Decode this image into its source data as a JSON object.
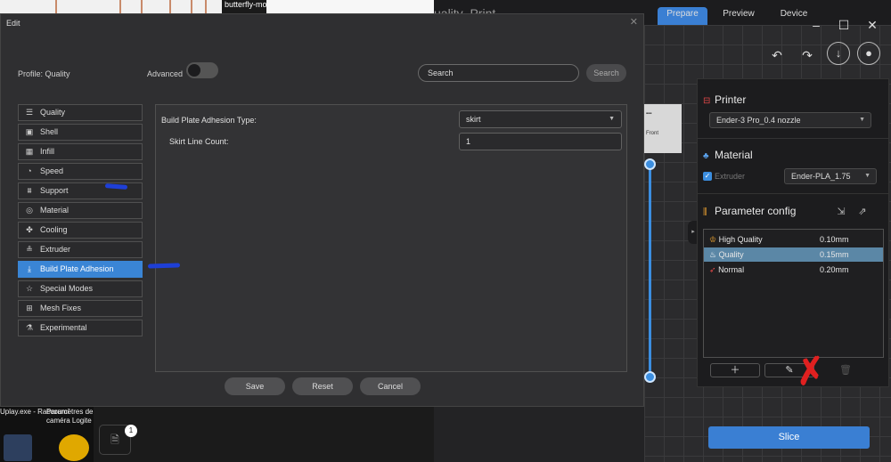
{
  "desktop": {
    "window_tab_label": "butterfly-mo",
    "icon_uplay": "Uplay.exe - Raccourci",
    "icon_camera": "Paramètres de caméra Logite",
    "notification_count": "1"
  },
  "app": {
    "title": "uality_Print",
    "tabs": [
      "Prepare",
      "Preview",
      "Device"
    ],
    "printer": {
      "heading": "Printer",
      "selected": "Ender-3 Pro_0.4 nozzle"
    },
    "material": {
      "heading": "Material",
      "extruder_label": "Extruder",
      "selected": "Ender-PLA_1.75"
    },
    "parameter_config": {
      "heading": "Parameter config",
      "items": [
        {
          "name": "High Quality",
          "value": "0.10mm",
          "icon": "crown-icon"
        },
        {
          "name": "Quality",
          "value": "0.15mm",
          "icon": "flame-icon",
          "selected": true
        },
        {
          "name": "Normal",
          "value": "0.20mm",
          "icon": "rocket-icon"
        }
      ]
    },
    "slice_label": "Slice",
    "view_cube_label": "Front"
  },
  "dialog": {
    "title": "Edit",
    "profile_label": "Profile:  Quality",
    "advanced_label": "Advanced",
    "search_placeholder": "Search",
    "search_button": "Search",
    "categories": [
      {
        "label": "Quality",
        "icon": "layers-icon"
      },
      {
        "label": "Shell",
        "icon": "shell-icon"
      },
      {
        "label": "Infill",
        "icon": "infill-icon"
      },
      {
        "label": "Speed",
        "icon": "speed-icon"
      },
      {
        "label": "Support",
        "icon": "support-icon"
      },
      {
        "label": "Material",
        "icon": "material-icon"
      },
      {
        "label": "Cooling",
        "icon": "fan-icon"
      },
      {
        "label": "Extruder",
        "icon": "extruder-icon"
      },
      {
        "label": "Build Plate Adhesion",
        "icon": "adhesion-icon",
        "active": true
      },
      {
        "label": "Special Modes",
        "icon": "star-icon"
      },
      {
        "label": "Mesh Fixes",
        "icon": "mesh-fix-icon"
      },
      {
        "label": "Experimental",
        "icon": "flask-icon"
      }
    ],
    "settings": {
      "adhesion_type_label": "Build Plate Adhesion Type:",
      "adhesion_type_value": "skirt",
      "skirt_line_count_label": "Skirt Line Count:",
      "skirt_line_count_value": "1"
    },
    "buttons": {
      "save": "Save",
      "reset": "Reset",
      "cancel": "Cancel"
    }
  },
  "colors": {
    "accent": "#3a85d5",
    "selected_param": "#5b87a6",
    "annotation_blue": "#1e3fd6",
    "annotation_red": "#e02020"
  }
}
